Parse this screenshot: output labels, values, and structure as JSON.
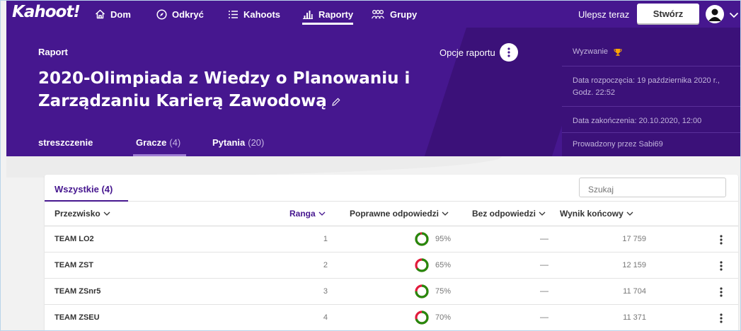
{
  "nav": {
    "logo": "Kahoot!",
    "items": [
      {
        "label": "Dom",
        "icon": "home-icon"
      },
      {
        "label": "Odkryć",
        "icon": "compass-icon"
      },
      {
        "label": "Kahoots",
        "icon": "list-icon"
      },
      {
        "label": "Raporty",
        "icon": "reports-icon",
        "active": true
      },
      {
        "label": "Grupy",
        "icon": "groups-icon"
      }
    ],
    "upgrade": "Ulepsz teraz",
    "create": "Stwórz"
  },
  "report": {
    "label": "Raport",
    "title": "2020-Olimpiada z Wiedzy o Planowaniu i Zarządzaniu Karierą Zawodową",
    "options": "Opcje raportu",
    "tabs": [
      {
        "label": "streszczenie",
        "count": ""
      },
      {
        "label": "Gracze",
        "count": "(4)",
        "active": true
      },
      {
        "label": "Pytania",
        "count": "(20)"
      }
    ]
  },
  "info": {
    "challenge": "Wyzwanie",
    "start": "Data rozpoczęcia: 19 października 2020 r., Godz. 22:52",
    "end": "Data zakończenia: 20.10.2020, 12:00",
    "host": "Prowadzony przez Sabi69"
  },
  "table": {
    "filter": "Wszystkie (4)",
    "search_placeholder": "Szukaj",
    "headers": {
      "nickname": "Przezwisko",
      "rank": "Ranga",
      "correct": "Poprawne odpowiedzi",
      "noanswer": "Bez odpowiedzi",
      "score": "Wynik końcowy"
    },
    "rows": [
      {
        "name": "TEAM LO2",
        "rank": "1",
        "pct": "95%",
        "correct_fraction": 0.95,
        "noanswer": "—",
        "score": "17 759"
      },
      {
        "name": "TEAM ZST",
        "rank": "2",
        "pct": "65%",
        "correct_fraction": 0.65,
        "noanswer": "—",
        "score": "12 159"
      },
      {
        "name": "TEAM ZSnr5",
        "rank": "3",
        "pct": "75%",
        "correct_fraction": 0.75,
        "noanswer": "—",
        "score": "11 704"
      },
      {
        "name": "TEAM ZSEU",
        "rank": "4",
        "pct": "70%",
        "correct_fraction": 0.7,
        "noanswer": "—",
        "score": "11 371"
      }
    ]
  },
  "colors": {
    "brand_purple": "#46178f",
    "dark_purple": "#3b1179",
    "correct_green": "#26890c",
    "wrong_red": "#e21b3c",
    "trophy": "#ffa602"
  }
}
